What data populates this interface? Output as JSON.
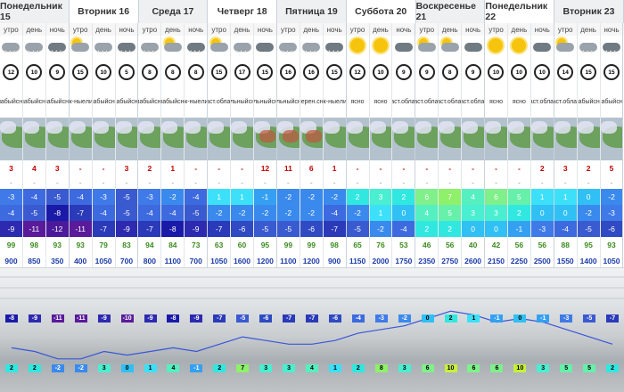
{
  "days": [
    {
      "label": "Понедельник 15"
    },
    {
      "label": "Вторник 16"
    },
    {
      "label": "Среда 17"
    },
    {
      "label": "Четверг 18"
    },
    {
      "label": "Пятница 19"
    },
    {
      "label": "Суббота 20"
    },
    {
      "label": "Воскресенье 21"
    },
    {
      "label": "Понедельник 22"
    },
    {
      "label": "Вторник 23"
    }
  ],
  "times_of_day": [
    "утро",
    "день",
    "ночь"
  ],
  "colors": {
    "temp_scale": {
      "-12": "#4a1a9a",
      "-11": "#5a1a9a",
      "-9": "#2d2ab0",
      "-8": "#1a1aa8",
      "-7": "#2a3ab8",
      "-6": "#2f4ac2",
      "-5": "#3a5ad0",
      "-4": "#3d6ade",
      "-3": "#3f7ae8",
      "-2": "#3a8aee",
      "-1": "#35a0f2",
      "0": "#30c0f4",
      "1": "#3ce0f8",
      "2": "#30e8e0",
      "3": "#4aeed0",
      "4": "#56efc0",
      "5": "#66f0aa",
      "6": "#7ff08a",
      "7": "#8ff06a",
      "10": "#c8f038"
    },
    "humidity": "#3a8c1f",
    "pressure": "#1a3aa8",
    "precip": "#c00000",
    "graph_line": "#3a55d8"
  },
  "slots": [
    {
      "icon": "cloud-snow-icon",
      "wind": "12",
      "desc": [
        "слабый",
        "снег"
      ],
      "precip": "3",
      "mm": "-",
      "tmax": "-3",
      "tmin": "-4",
      "tnight": "-9",
      "hum": "99",
      "press": "900"
    },
    {
      "icon": "cloud-snow-icon",
      "wind": "10",
      "desc": [
        "слабый",
        "снег"
      ],
      "precip": "4",
      "mm": "-",
      "tmax": "-4",
      "tmin": "-5",
      "tnight": "-11",
      "hum": "98",
      "press": "850"
    },
    {
      "icon": "cloud-snow-night-icon",
      "wind": "9",
      "desc": [
        "слабый",
        "снег"
      ],
      "precip": "3",
      "mm": "-",
      "tmax": "-5",
      "tmin": "-8",
      "tnight": "-12",
      "hum": "93",
      "press": "350"
    },
    {
      "icon": "sun-cloud-icon",
      "wind": "15",
      "desc": [
        "снеж-",
        "ные",
        "ливни"
      ],
      "precip": "-",
      "mm": "-",
      "tmax": "-4",
      "tmin": "-7",
      "tnight": "-11",
      "hum": "93",
      "press": "400"
    },
    {
      "icon": "cloud-snow-icon",
      "wind": "10",
      "desc": [
        "слабый",
        "снег"
      ],
      "precip": "-",
      "mm": "-",
      "tmax": "-3",
      "tmin": "-4",
      "tnight": "-7",
      "hum": "79",
      "press": "1050"
    },
    {
      "icon": "cloud-snow-night-icon",
      "wind": "5",
      "desc": [
        "слабый",
        "снег"
      ],
      "precip": "3",
      "mm": "-",
      "tmax": "-5",
      "tmin": "-5",
      "tnight": "-9",
      "hum": "83",
      "press": "700"
    },
    {
      "icon": "cloud-snow-icon",
      "wind": "8",
      "desc": [
        "слабый",
        "снег"
      ],
      "precip": "2",
      "mm": "-",
      "tmax": "-3",
      "tmin": "-4",
      "tnight": "-7",
      "hum": "94",
      "press": "800"
    },
    {
      "icon": "sun-cloud-icon",
      "wind": "8",
      "desc": [
        "слабый",
        "снег"
      ],
      "precip": "1",
      "mm": "-",
      "tmax": "-2",
      "tmin": "-4",
      "tnight": "-8",
      "hum": "84",
      "press": "1100"
    },
    {
      "icon": "cloud-snow-night-icon",
      "wind": "8",
      "desc": [
        "снеж-",
        "ные",
        "ливни"
      ],
      "precip": "-",
      "mm": "-",
      "tmax": "-4",
      "tmin": "-5",
      "tnight": "-9",
      "hum": "73",
      "press": "700"
    },
    {
      "icon": "sun-cloud-icon",
      "wind": "15",
      "desc": [
        "част.",
        "облач."
      ],
      "precip": "-",
      "mm": "-",
      "tmax": "1",
      "tmin": "-2",
      "tnight": "-7",
      "hum": "63",
      "press": "1050"
    },
    {
      "icon": "cloud-snow-icon",
      "wind": "17",
      "desc": [
        "сильный",
        "снег"
      ],
      "precip": "-",
      "mm": "-",
      "tmax": "1",
      "tmin": "-2",
      "tnight": "-6",
      "hum": "60",
      "press": "1600"
    },
    {
      "icon": "cloud-night-icon",
      "wind": "15",
      "desc": [
        "сильный",
        "снег"
      ],
      "precip": "12",
      "mm": "-",
      "tmax": "-1",
      "tmin": "-2",
      "tnight": "-5",
      "hum": "95",
      "press": "1200"
    },
    {
      "icon": "cloud-snow-icon",
      "wind": "16",
      "desc": [
        "сильный",
        "снег"
      ],
      "precip": "11",
      "mm": "-",
      "tmax": "-2",
      "tmin": "-2",
      "tnight": "-5",
      "hum": "99",
      "press": "1100"
    },
    {
      "icon": "cloud-snow-icon",
      "wind": "16",
      "desc": [
        "умерен.",
        "снег"
      ],
      "precip": "6",
      "mm": "-",
      "tmax": "-2",
      "tmin": "-2",
      "tnight": "-6",
      "hum": "99",
      "press": "1200"
    },
    {
      "icon": "cloud-snow-night-icon",
      "wind": "15",
      "desc": [
        "снеж-",
        "ные",
        "ливни"
      ],
      "precip": "1",
      "mm": "-",
      "tmax": "-2",
      "tmin": "-4",
      "tnight": "-7",
      "hum": "98",
      "press": "900"
    },
    {
      "icon": "sun-icon",
      "wind": "12",
      "desc": [
        "ясно"
      ],
      "precip": "-",
      "mm": "-",
      "tmax": "2",
      "tmin": "-2",
      "tnight": "-5",
      "hum": "65",
      "press": "1150"
    },
    {
      "icon": "sun-icon",
      "wind": "10",
      "desc": [
        "ясно"
      ],
      "precip": "-",
      "mm": "-",
      "tmax": "3",
      "tmin": "1",
      "tnight": "-2",
      "hum": "76",
      "press": "2000"
    },
    {
      "icon": "cloud-night-icon",
      "wind": "9",
      "desc": [
        "част.",
        "облач."
      ],
      "precip": "-",
      "mm": "-",
      "tmax": "2",
      "tmin": "0",
      "tnight": "-4",
      "hum": "53",
      "press": "1750"
    },
    {
      "icon": "sun-cloud-icon",
      "wind": "9",
      "desc": [
        "част.",
        "облач."
      ],
      "precip": "-",
      "mm": "-",
      "tmax": "6",
      "tmin": "4",
      "tnight": "2",
      "hum": "46",
      "press": "2350"
    },
    {
      "icon": "sun-cloud-icon",
      "wind": "8",
      "desc": [
        "част.",
        "облач."
      ],
      "precip": "-",
      "mm": "-",
      "tmax": "7",
      "tmin": "5",
      "tnight": "2",
      "hum": "56",
      "press": "2750"
    },
    {
      "icon": "cloud-night-icon",
      "wind": "9",
      "desc": [
        "част.",
        "облач."
      ],
      "precip": "-",
      "mm": "-",
      "tmax": "4",
      "tmin": "3",
      "tnight": "0",
      "hum": "40",
      "press": "2600"
    },
    {
      "icon": "sun-icon",
      "wind": "10",
      "desc": [
        "ясно"
      ],
      "precip": "-",
      "mm": "-",
      "tmax": "6",
      "tmin": "3",
      "tnight": "0",
      "hum": "42",
      "press": "2150"
    },
    {
      "icon": "sun-icon",
      "wind": "10",
      "desc": [
        "ясно"
      ],
      "precip": "-",
      "mm": "-",
      "tmax": "5",
      "tmin": "2",
      "tnight": "-1",
      "hum": "56",
      "press": "2250"
    },
    {
      "icon": "cloud-night-icon",
      "wind": "10",
      "desc": [
        "част.",
        "облач."
      ],
      "precip": "2",
      "mm": "-",
      "tmax": "1",
      "tmin": "0",
      "tnight": "-3",
      "hum": "56",
      "press": "2500"
    },
    {
      "icon": "sun-cloud-icon",
      "wind": "14",
      "desc": [
        "част.",
        "облач."
      ],
      "precip": "3",
      "mm": "-",
      "tmax": "1",
      "tmin": "0",
      "tnight": "-4",
      "hum": "88",
      "press": "1550"
    },
    {
      "icon": "cloud-snow-icon",
      "wind": "15",
      "desc": [
        "слабый",
        "снег"
      ],
      "precip": "2",
      "mm": "-",
      "tmax": "0",
      "tmin": "-2",
      "tnight": "-5",
      "hum": "95",
      "press": "1400"
    },
    {
      "icon": "cloud-snow-night-icon",
      "wind": "15",
      "desc": [
        "слабый",
        "снег"
      ],
      "precip": "5",
      "mm": "-",
      "tmax": "-2",
      "tmin": "-3",
      "tnight": "-6",
      "hum": "93",
      "press": "1050"
    }
  ],
  "graph": {
    "top_labels": [
      "-8",
      "-9",
      "-11",
      "-11",
      "-9",
      "-10",
      "-9",
      "-8",
      "-9",
      "-7",
      "-5",
      "-6",
      "-7",
      "-7",
      "-6",
      "-4",
      "-3",
      "-2",
      "0",
      "2",
      "1",
      "-1",
      "0",
      "-1",
      "-3",
      "-5",
      "-7"
    ],
    "bottom_labels": [
      "2",
      "2",
      "-2",
      "-2",
      "3",
      "0",
      "1",
      "4",
      "-1",
      "2",
      "7",
      "3",
      "3",
      "4",
      "1",
      "2",
      "8",
      "3",
      "6",
      "10",
      "6",
      "6",
      "10",
      "3",
      "5",
      "5",
      "2"
    ],
    "line_values": [
      -8,
      -9,
      -11,
      -11,
      -9,
      -10,
      -9,
      -8,
      -9,
      -7,
      -5,
      -6,
      -7,
      -7,
      -6,
      -4,
      -3,
      -2,
      0,
      2,
      1,
      -1,
      0,
      -1,
      -3,
      -5,
      -7
    ]
  }
}
